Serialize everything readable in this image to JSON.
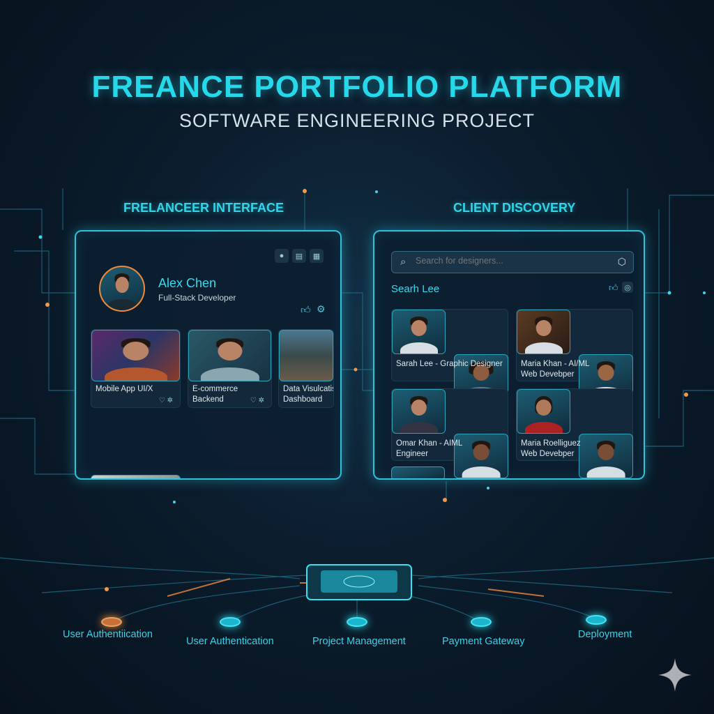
{
  "header": {
    "title": "FREANCE PORTFOLIO PLATFORM",
    "subtitle": "SOFTWARE ENGINEERING PROJECT"
  },
  "freelancer": {
    "section_title": "FRELANCEER INTERFACE",
    "name": "Alex Chen",
    "role": "Full-Stack Developer",
    "projects": [
      {
        "line1": "Mobile App UI/X",
        "line2": ""
      },
      {
        "line1": "E-commerce",
        "line2": "Backend"
      },
      {
        "line1": "Data Visulcatis",
        "line2": "Dashboard"
      }
    ]
  },
  "client": {
    "section_title": "CLIENT DISCOVERY",
    "search_placeholder": "Search for designers...",
    "result_heading": "Searh Lee",
    "results": [
      {
        "line1": "Sarah Lee - Graphic Designer",
        "line2": ""
      },
      {
        "line1": "Maria Khan - AI/ML",
        "line2": "Web Devebper"
      },
      {
        "line1": "Omar Khan - AIML",
        "line2": "Engineer"
      },
      {
        "line1": "Maria Roelliguez",
        "line2": "Web Devebper"
      }
    ]
  },
  "modules": [
    "User Authentiication",
    "User Authentication",
    "Project Management",
    "Payment Gateway",
    "Deployment"
  ],
  "colors": {
    "accent": "#25d8ea",
    "orange": "#f08a3c",
    "bg": "#0b1c2c"
  }
}
